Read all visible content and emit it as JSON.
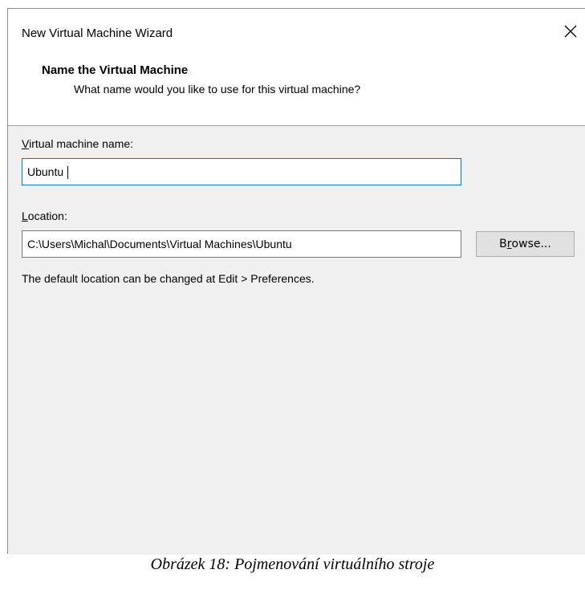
{
  "window": {
    "title": "New Virtual Machine Wizard",
    "close_icon": "close-icon"
  },
  "header": {
    "title": "Name the Virtual Machine",
    "subtitle": "What name would you like to use for this virtual machine?"
  },
  "name_field": {
    "label_accel": "V",
    "label_rest": "irtual machine name:",
    "value": "Ubuntu"
  },
  "location_field": {
    "label_accel": "L",
    "label_rest": "ocation:",
    "value": "C:\\Users\\Michal\\Documents\\Virtual Machines\\Ubuntu"
  },
  "browse_button": {
    "label_pre": "B",
    "label_accel": "r",
    "label_post": "owse..."
  },
  "hint": "The default location can be changed at Edit > Preferences.",
  "caption": "Obrázek  18: Pojmenování virtuálního stroje",
  "colors": {
    "focus_border": "#0078d7",
    "content_bg": "#f0f0f0"
  }
}
